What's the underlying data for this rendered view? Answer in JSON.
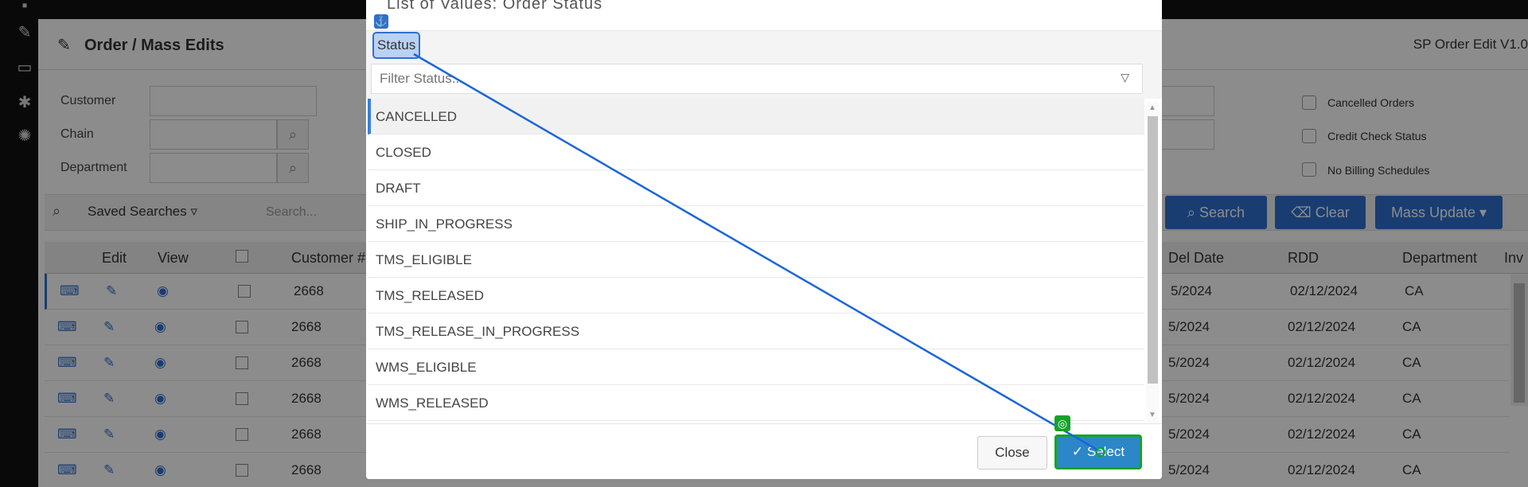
{
  "app": {
    "title": "Order / Mass Edits",
    "version": "SP Order Edit V1.0"
  },
  "left_rail": {
    "icons": [
      "edit-icon",
      "id-card-icon",
      "asterisk-icon",
      "dollar-badge-icon"
    ]
  },
  "filters": {
    "customer_label": "Customer",
    "chain_label": "Chain",
    "department_label": "Department",
    "checkboxes": [
      "Cancelled Orders",
      "Credit Check Status",
      "No Billing Schedules"
    ]
  },
  "search_bar": {
    "saved_searches": "Saved Searches",
    "placeholder": "Search...",
    "search_button": "Search",
    "clear_button": "Clear",
    "mass_update_button": "Mass Update"
  },
  "grid": {
    "columns": [
      "Edit",
      "View",
      "Customer #",
      "Del Date",
      "RDD",
      "Department",
      "Inv"
    ],
    "rows": [
      {
        "customer": "2668",
        "del_date": "5/2024",
        "rdd": "02/12/2024",
        "department": "CA"
      },
      {
        "customer": "2668",
        "del_date": "5/2024",
        "rdd": "02/12/2024",
        "department": "CA"
      },
      {
        "customer": "2668",
        "del_date": "5/2024",
        "rdd": "02/12/2024",
        "department": "CA"
      },
      {
        "customer": "2668",
        "del_date": "5/2024",
        "rdd": "02/12/2024",
        "department": "CA"
      },
      {
        "customer": "2668",
        "del_date": "5/2024",
        "rdd": "02/12/2024",
        "department": "CA"
      },
      {
        "customer": "2668",
        "del_date": "5/2024",
        "rdd": "02/12/2024",
        "department": "CA"
      }
    ]
  },
  "modal": {
    "title": "List of Values: Order Status",
    "chip_label": "Status",
    "filter_placeholder": "Filter Status...",
    "items": [
      "CANCELLED",
      "CLOSED",
      "DRAFT",
      "SHIP_IN_PROGRESS",
      "TMS_ELIGIBLE",
      "TMS_RELEASED",
      "TMS_RELEASE_IN_PROGRESS",
      "WMS_ELIGIBLE",
      "WMS_RELEASED"
    ],
    "active_item": "CANCELLED",
    "close_button": "Close",
    "select_button": "Select"
  },
  "colors": {
    "accent": "#2f6fce",
    "select_border": "#14a328",
    "select_fill": "#2c87c8"
  }
}
